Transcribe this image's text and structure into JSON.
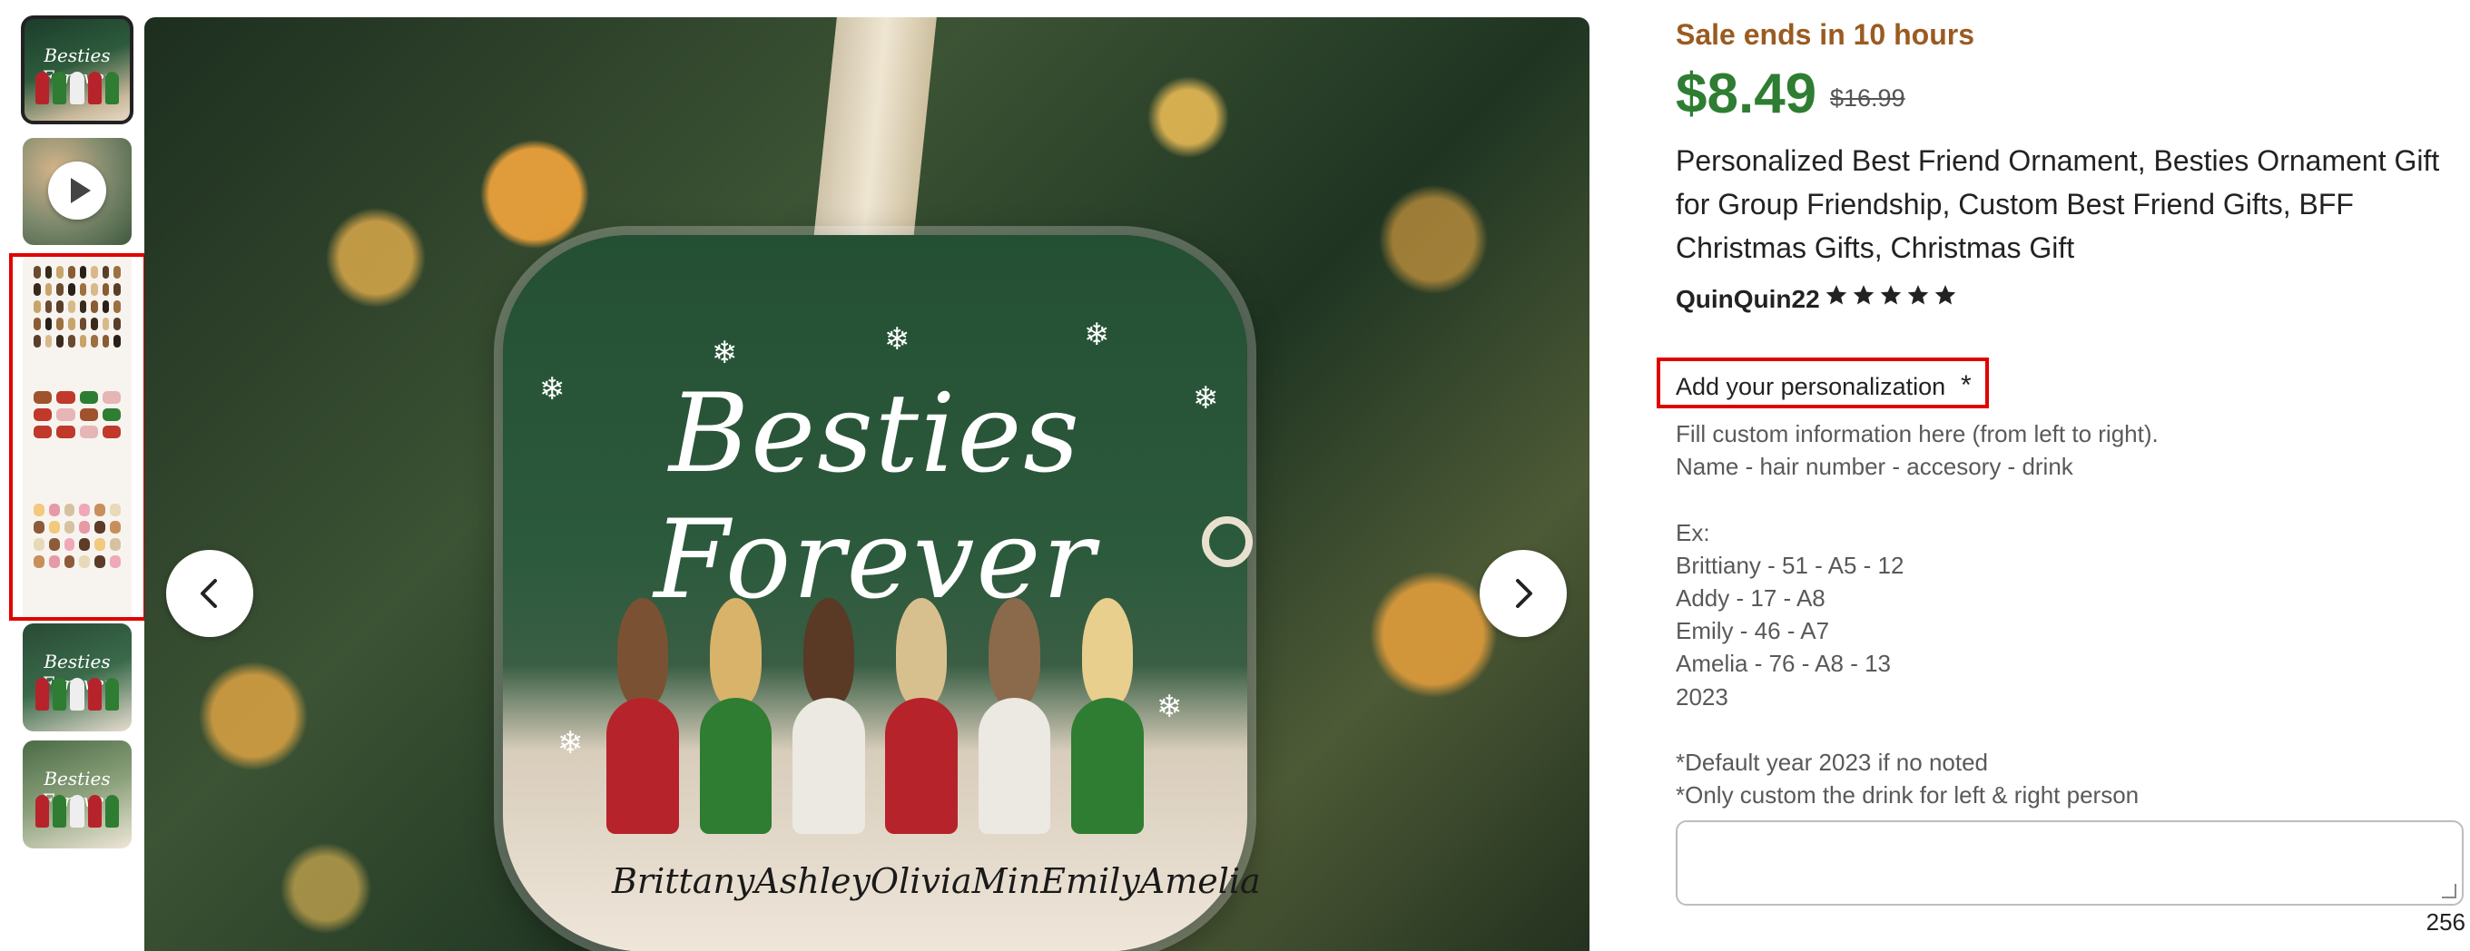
{
  "thumbnails": {
    "items": [
      {
        "name": "ornament-front",
        "mini_title": "Besties Forever"
      },
      {
        "name": "video",
        "mini_title": ""
      },
      {
        "name": "options-chart",
        "mini_title": ""
      },
      {
        "name": "ornament-variant-a",
        "mini_title": "Besties Forever"
      },
      {
        "name": "ornament-variant-b",
        "mini_title": "Besties Forever"
      }
    ]
  },
  "main_image": {
    "ornament_title": "Besties Forever",
    "names": [
      "Brittany",
      "Ashley",
      "Olivia",
      "Min",
      "Emily",
      "Amelia"
    ]
  },
  "product": {
    "sale_text": "Sale ends in 10 hours",
    "price": "$8.49",
    "original_price": "$16.99",
    "title": "Personalized Best Friend Ornament, Besties Ornament Gift for Group Friendship, Custom Best Friend Gifts, BFF Christmas Gifts, Christmas Gift",
    "shop_name": "QuinQuin22",
    "rating": 5,
    "rating_max": 5
  },
  "personalization": {
    "label": "Add your personalization",
    "required_mark": "*",
    "instructions": "Fill custom information here (from left to right).\nName - hair number - accesory - drink\n\nEx:\nBrittiany - 51 - A5 - 12\nAddy - 17 - A8\nEmily - 46 - A7\nAmelia - 76 - A8 - 13\n2023\n\n*Default year 2023 if no noted\n*Only custom the drink for left & right person",
    "input_value": "",
    "char_counter": "256"
  },
  "colors": {
    "sale": "#9a5b21",
    "price": "#2e7d32",
    "highlight": "#e10000"
  }
}
